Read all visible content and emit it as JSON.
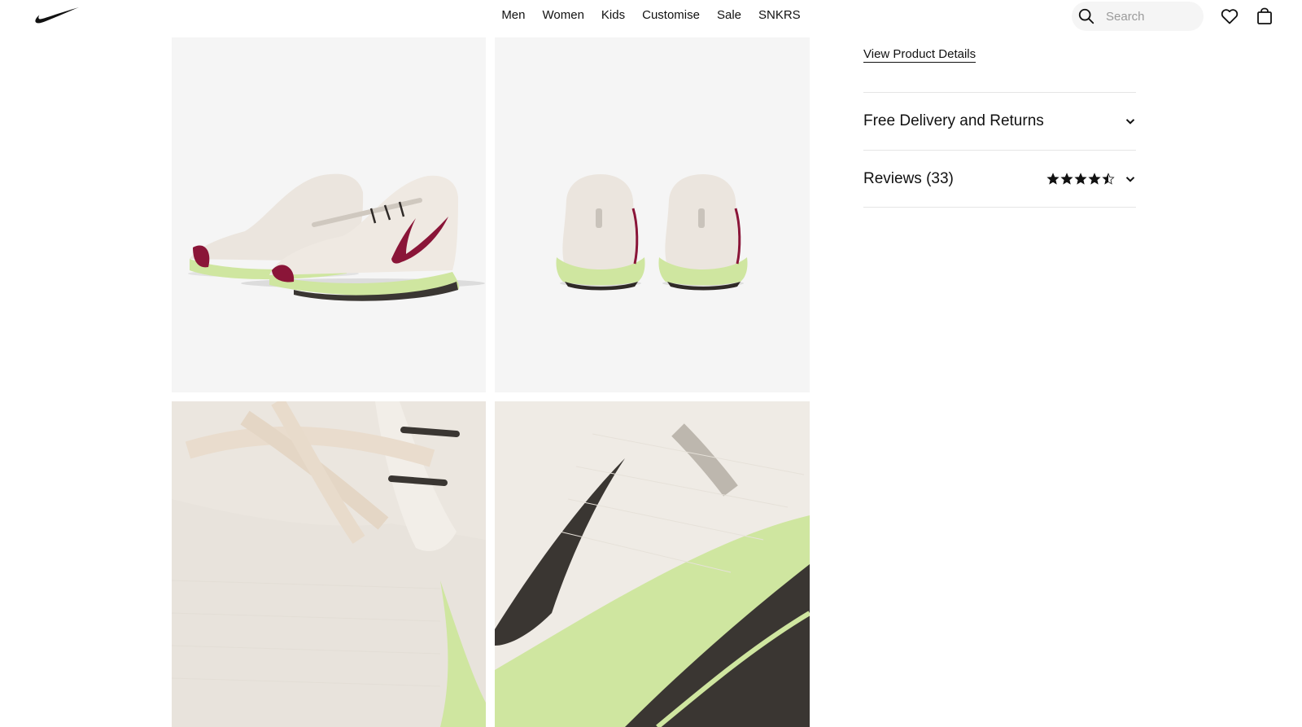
{
  "header": {
    "logo_label": "Nike",
    "nav": [
      "Men",
      "Women",
      "Kids",
      "Customise",
      "Sale",
      "SNKRS"
    ],
    "search": {
      "placeholder": "Search",
      "value": ""
    },
    "icons": {
      "search": "search-icon",
      "favourites": "heart-icon",
      "bag": "bag-icon",
      "logo": "nike-swoosh-logo"
    }
  },
  "gallery": {
    "images": [
      "shoe-pair-side-view",
      "shoe-pair-back-view",
      "shoe-laces-closeup",
      "shoe-swoosh-sole-closeup"
    ],
    "colors": {
      "background": "#f5f5f5",
      "upper": "#ece7e0",
      "sole": "#cfe6a0",
      "swoosh": "#8a1538",
      "outsole": "#3a3632"
    }
  },
  "product": {
    "view_details": "View Product Details",
    "delivery_title": "Free Delivery and Returns",
    "reviews_title": "Reviews (33)",
    "rating": 4.5,
    "rating_max": 5
  }
}
